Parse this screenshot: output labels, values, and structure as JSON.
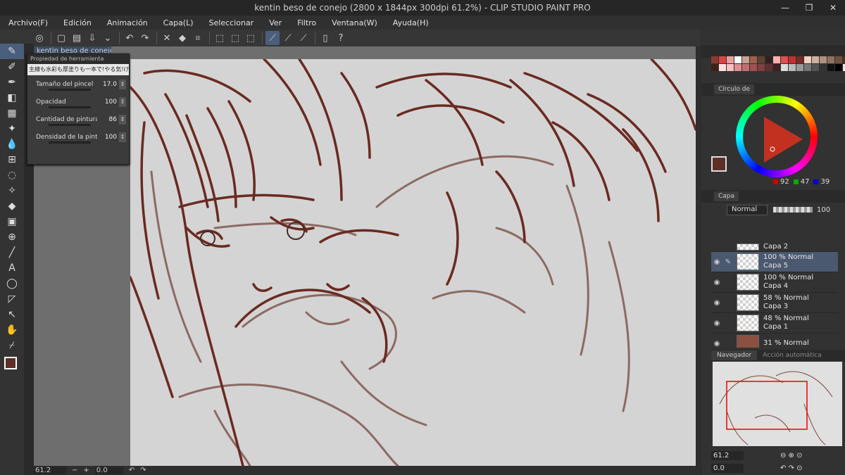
{
  "window": {
    "title": "kentin beso de conejo (2800 x 1844px 300dpi 61.2%) - CLIP STUDIO PAINT PRO",
    "controls": [
      "—",
      "❐",
      "✕"
    ]
  },
  "menu": [
    "Archivo(F)",
    "Edición",
    "Animación",
    "Capa(L)",
    "Seleccionar",
    "Ver",
    "Filtro",
    "Ventana(W)",
    "Ayuda(H)"
  ],
  "canvas": {
    "tab_label": "kentin beso de conejo",
    "zoom": "61.2",
    "angle": "0.0"
  },
  "tool_property": {
    "title": "Propiedad de herramienta",
    "preset": "主線も水彩も厚塗りも一本で!やる気!けものブ",
    "rows": [
      {
        "label": "Tamaño del pincel",
        "value": "17.0"
      },
      {
        "label": "Opacidad",
        "value": "100"
      },
      {
        "label": "Cantidad de pintura",
        "value": "86"
      },
      {
        "label": "Densidad de la pintura",
        "value": "100"
      }
    ]
  },
  "color": {
    "panel_title": "Círculo de",
    "r": "92",
    "g": "47",
    "b": "39",
    "main": "#5c2f27",
    "swatch_colors": [
      "#8a3a30",
      "#d44",
      "#e8a0a0",
      "#fff",
      "#c8a090",
      "#a06050",
      "#604030",
      "#302020",
      "#ffb0b0",
      "#e05050",
      "#c03030",
      "#7a2828",
      "#f0d0c0",
      "#d0b0a0",
      "#b09080",
      "#907060",
      "#705040",
      "#503020",
      "#402018",
      "#ffe0e0",
      "#ffc0c0",
      "#e09090",
      "#c07070",
      "#a05050",
      "#804040",
      "#603030",
      "#402020",
      "#ddd",
      "#bbb",
      "#999",
      "#777",
      "#555",
      "#333",
      "#111",
      "#000",
      "#fdd"
    ]
  },
  "layers": {
    "panel_title": "Capa",
    "blend_mode": "Normal",
    "opacity": "100",
    "items": [
      {
        "opacity": "",
        "name": "Capa 2",
        "selected": false
      },
      {
        "opacity": "100 % Normal",
        "name": "Capa 5",
        "selected": true
      },
      {
        "opacity": "100 % Normal",
        "name": "Capa 4",
        "selected": false
      },
      {
        "opacity": "58 % Normal",
        "name": "Capa 3",
        "selected": false
      },
      {
        "opacity": "48 % Normal",
        "name": "Capa 1",
        "selected": false
      },
      {
        "opacity": "31 % Normal",
        "name": "",
        "selected": false
      }
    ]
  },
  "navigator": {
    "tab": "Navegador",
    "tab2": "Acción automática",
    "zoom": "61.2",
    "angle": "0.0"
  }
}
